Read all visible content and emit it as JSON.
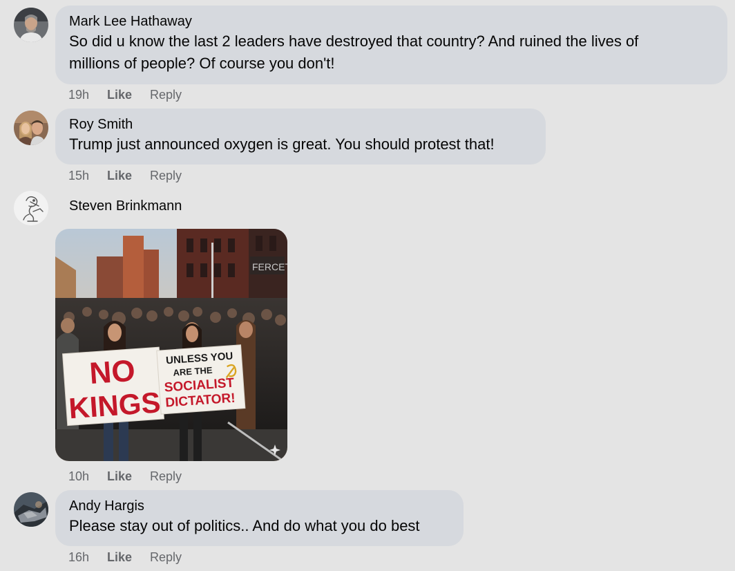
{
  "comments": [
    {
      "author": "Mark Lee Hathaway",
      "line1": "So did u know the last 2 leaders have destroyed that country? And ruined the lives of",
      "line2": "millions of people? Of course you don't!",
      "time": "19h",
      "like": "Like",
      "reply": "Reply"
    },
    {
      "author": "Roy Smith",
      "line1": "Trump just announced oxygen is great. You should protest that!",
      "time": "15h",
      "like": "Like",
      "reply": "Reply"
    },
    {
      "author": "Steven Brinkmann",
      "sign_left_line1": "NO",
      "sign_left_line2": "KINGS",
      "sign_right_line1": "UNLESS YOU",
      "sign_right_line2": "ARE THE",
      "sign_right_line3": "SOCIALIST",
      "sign_right_line4": "DICTATOR!",
      "storefront_text": "FERCET",
      "time": "10h",
      "like": "Like",
      "reply": "Reply"
    },
    {
      "author": "Andy Hargis",
      "line1": "Please stay out of politics.. And do what you do best",
      "time": "16h",
      "like": "Like",
      "reply": "Reply"
    }
  ],
  "colors": {
    "bubble": "#d6d9de",
    "background": "#e4e4e4",
    "meta": "#65676b",
    "sign_red": "#c4182a"
  }
}
